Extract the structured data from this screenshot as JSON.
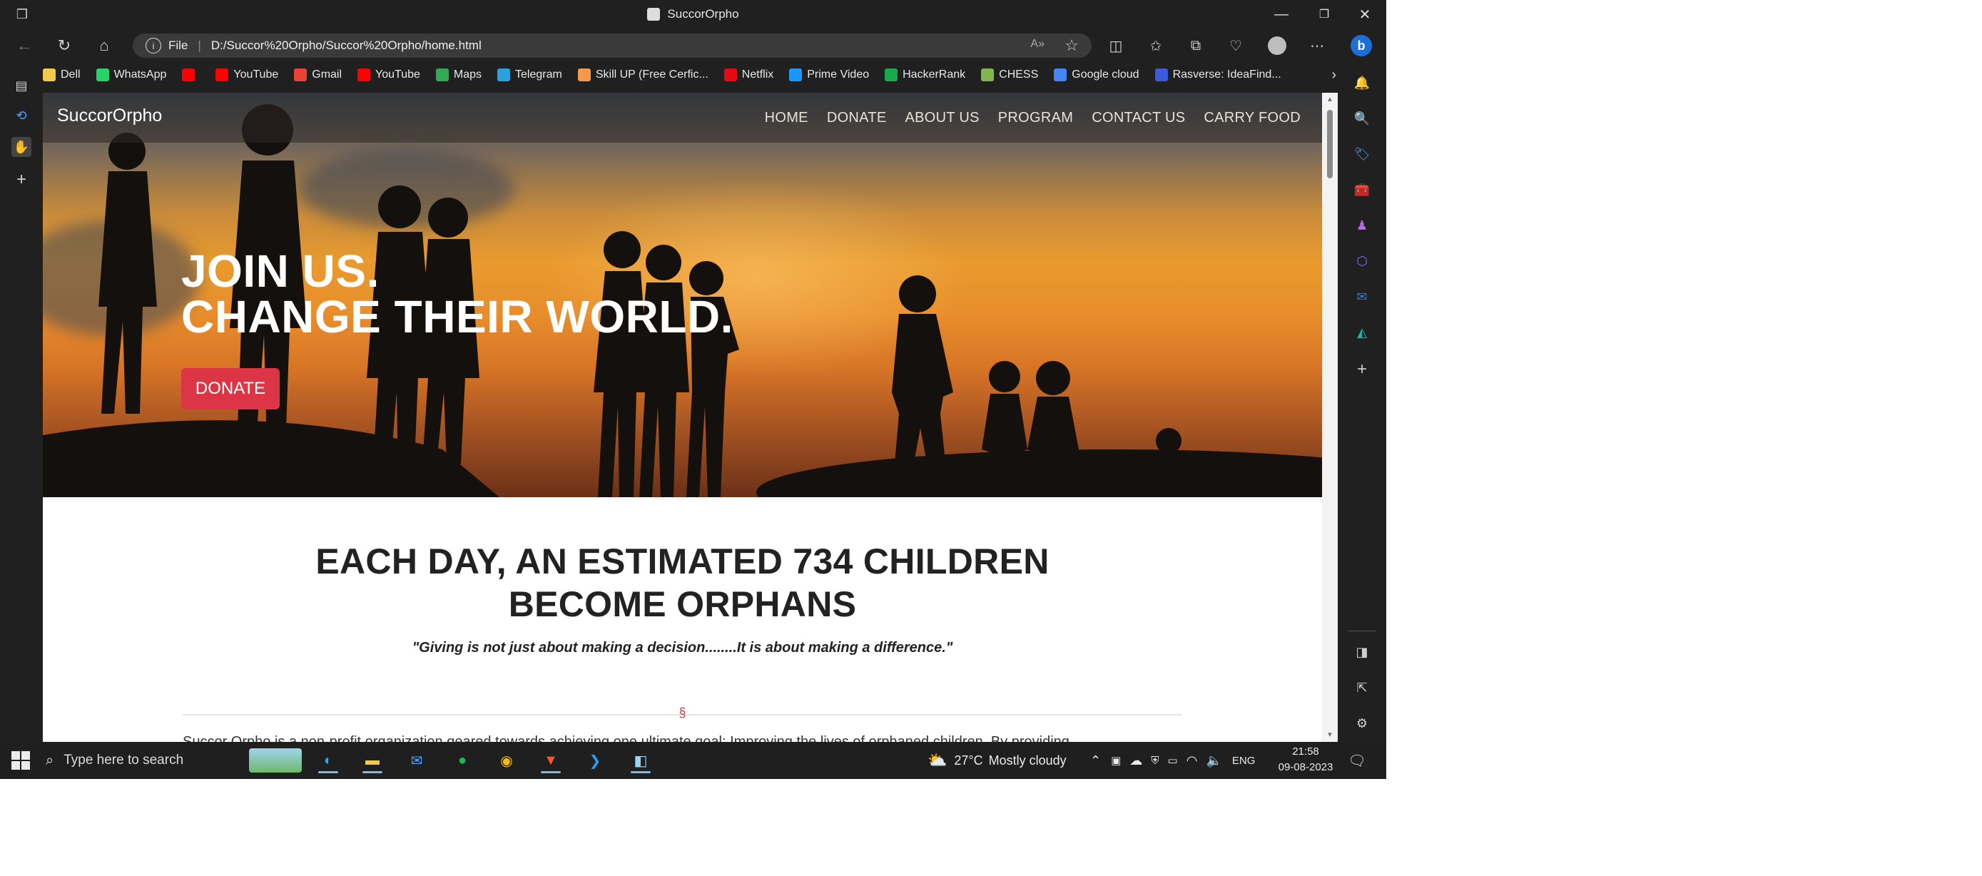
{
  "window": {
    "title": "SuccorOrpho",
    "controls": [
      "minimize",
      "restore",
      "close"
    ]
  },
  "browser": {
    "address_scheme": "File",
    "address_url": "D:/Succor%20Orpho/Succor%20Orpho/home.html",
    "bookmarks": [
      {
        "label": "Dell",
        "icon": "folder-icon",
        "color": "#f2c94c"
      },
      {
        "label": "WhatsApp",
        "icon": "whatsapp-icon",
        "color": "#25d366"
      },
      {
        "label": "",
        "icon": "youtube-icon",
        "color": "#ff0000"
      },
      {
        "label": "YouTube",
        "icon": "youtube-icon",
        "color": "#ff0000"
      },
      {
        "label": "Gmail",
        "icon": "gmail-icon",
        "color": "#ea4335"
      },
      {
        "label": "YouTube",
        "icon": "youtube-icon",
        "color": "#ff0000"
      },
      {
        "label": "Maps",
        "icon": "maps-icon",
        "color": "#34a853"
      },
      {
        "label": "Telegram",
        "icon": "telegram-icon",
        "color": "#2aa1da"
      },
      {
        "label": "Skill UP (Free Cerfic...",
        "icon": "skillup-icon",
        "color": "#f2994a"
      },
      {
        "label": "Netflix",
        "icon": "netflix-icon",
        "color": "#e50914"
      },
      {
        "label": "Prime Video",
        "icon": "prime-video-icon",
        "color": "#1a98ff"
      },
      {
        "label": "HackerRank",
        "icon": "hackerrank-icon",
        "color": "#1ba94c"
      },
      {
        "label": "CHESS",
        "icon": "chess-icon",
        "color": "#81b64c"
      },
      {
        "label": "Google cloud",
        "icon": "google-icon",
        "color": "#4285f4"
      },
      {
        "label": "Rasverse: IdeaFind...",
        "icon": "rasverse-icon",
        "color": "#3b5bdb"
      }
    ]
  },
  "site": {
    "brand": "SuccorOrpho",
    "nav": [
      "HOME",
      "DONATE",
      "ABOUT US",
      "PROGRAM",
      "CONTACT US",
      "CARRY FOOD"
    ],
    "hero_line1": "JOIN US.",
    "hero_line2": "CHANGE THEIR WORLD.",
    "donate_label": "DONATE",
    "accent": "#dc3545",
    "section_title_line1": "EACH DAY, AN ESTIMATED 734 CHILDREN",
    "section_title_line2": "BECOME ORPHANS",
    "quote": "\"Giving is not just about making a decision........It is about making a difference.\"",
    "divider_mark": "§",
    "intro": "Succor Orpho is a non-profit organization geared towards achieving one ultimate goal: Improving the lives of orphaned children. By providing..."
  },
  "taskbar": {
    "search_placeholder": "Type here to search",
    "weather_temp": "27°C",
    "weather_desc": "Mostly cloudy",
    "language": "ENG",
    "time": "21:58",
    "date": "09-08-2023"
  }
}
